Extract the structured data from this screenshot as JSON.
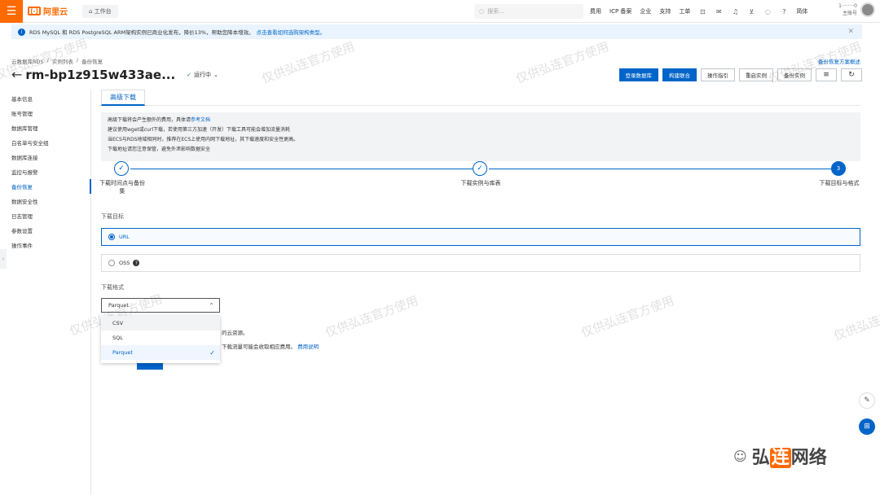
{
  "topbar": {
    "brand": "阿里云",
    "workbench": "工作台",
    "search_placeholder": "搜索...",
    "links": [
      "费用",
      "ICP 备案",
      "企业",
      "支持",
      "工单"
    ],
    "language": "简体",
    "account_id": "1········0",
    "account_role": "主账号"
  },
  "notice": {
    "text": "RDS MySQL 和 RDS PostgreSQL ARM架构实例已商业化发布，降价13%，帮助您降本增效。",
    "link": "点击查看如何选购架构类型。"
  },
  "breadcrumb": [
    "云数据库RDS",
    "实例列表",
    "备份恢复"
  ],
  "help_link": "备份恢复方案概述",
  "instance": {
    "title": "rm-bp1z915w433ae...",
    "status": "运行中"
  },
  "actions": [
    "登录数据库",
    "构建联合",
    "操作指引",
    "重启实例",
    "备份实例"
  ],
  "sidebar": {
    "items": [
      {
        "label": "基本信息",
        "active": false
      },
      {
        "label": "账号管理",
        "active": false
      },
      {
        "label": "数据库管理",
        "active": false
      },
      {
        "label": "白名单与安全组",
        "active": false
      },
      {
        "label": "数据库连接",
        "active": false
      },
      {
        "label": "监控与报警",
        "active": false
      },
      {
        "label": "备份恢复",
        "active": true
      },
      {
        "label": "数据安全性",
        "active": false
      },
      {
        "label": "日志管理",
        "active": false
      },
      {
        "label": "参数设置",
        "active": false
      },
      {
        "label": "操作事件",
        "active": false
      }
    ]
  },
  "tab": "高级下载",
  "tip": {
    "line1": "高级下载将会产生额外的费用，具体请",
    "line1_link": "参考文档",
    "line2": "建议使用wget或curl下载，若使用第三方加速（开发）下载工具可能会增加流量消耗",
    "line3": "当ECS与RDS地域相同时，推荐在ECS上使用内网下载地址，其下载速度和安全性更高。",
    "line4": "下载地址请您注意保管，避免外泄影响数据安全"
  },
  "steps": [
    {
      "label": "下载时间点与备份集",
      "state": "done"
    },
    {
      "label": "下载实例与库表",
      "state": "done"
    },
    {
      "label": "下载目标与格式",
      "state": "current",
      "number": "3"
    }
  ],
  "target": {
    "label": "下载目标",
    "options": [
      {
        "label": "URL",
        "selected": true
      },
      {
        "label": "OSS",
        "selected": false
      }
    ]
  },
  "format": {
    "label": "下载格式",
    "selected": "Parquet",
    "options": [
      {
        "label": "CSV",
        "state": "hover"
      },
      {
        "label": "SQL",
        "state": "normal"
      },
      {
        "label": "Parquet",
        "state": "selected"
      }
    ]
  },
  "obscured": {
    "line1_tail": "的云资源。",
    "line2_tail": "下载流量可能会收取相应费用。",
    "line2_link": "费用说明"
  },
  "watermark_text": "仅供弘连官方使用",
  "brand_watermark": {
    "pre": "弘",
    "hl": "连",
    "post": "网络"
  }
}
